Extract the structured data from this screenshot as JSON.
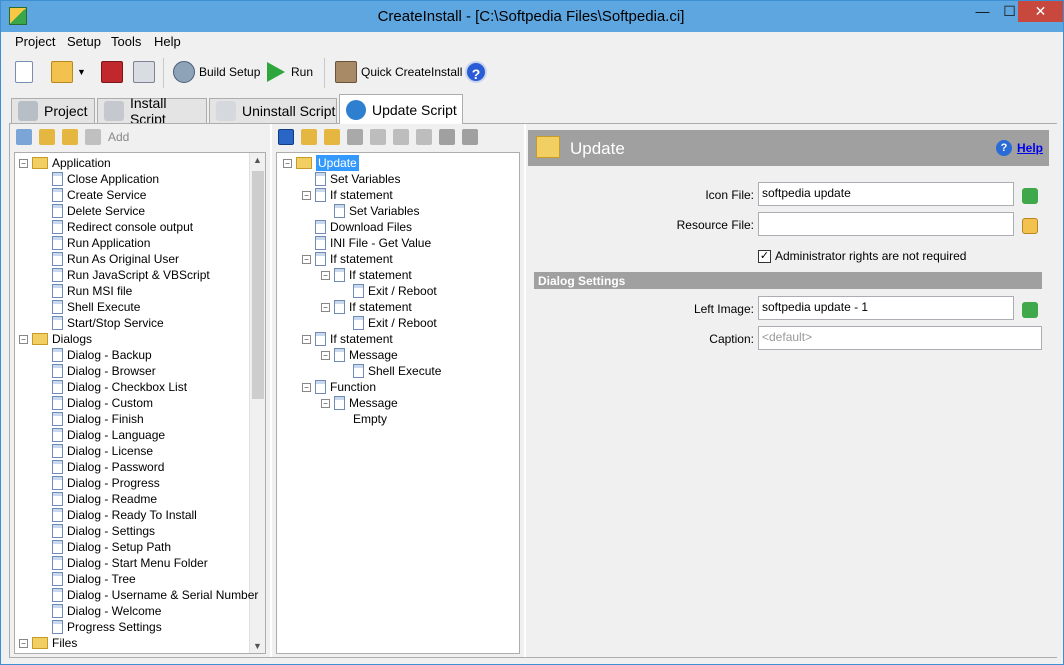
{
  "window": {
    "title": "CreateInstall - [C:\\Softpedia Files\\Softpedia.ci]",
    "min": "—",
    "max": "☐",
    "close": "✕"
  },
  "menu": [
    "Project",
    "Setup",
    "Tools",
    "Help"
  ],
  "toolbar": {
    "build": "Build Setup",
    "run": "Run",
    "quick": "Quick CreateInstall",
    "help": "?"
  },
  "tabs": [
    "Project",
    "Install Script",
    "Uninstall Script",
    "Update Script"
  ],
  "left": {
    "add": "Add",
    "items": [
      {
        "t": "Application",
        "f": 1,
        "l": 0
      },
      {
        "t": "Close Application",
        "l": 1
      },
      {
        "t": "Create Service",
        "l": 1
      },
      {
        "t": "Delete Service",
        "l": 1
      },
      {
        "t": "Redirect console output",
        "l": 1
      },
      {
        "t": "Run Application",
        "l": 1
      },
      {
        "t": "Run As Original User",
        "l": 1
      },
      {
        "t": "Run JavaScript & VBScript",
        "l": 1
      },
      {
        "t": "Run MSI file",
        "l": 1
      },
      {
        "t": "Shell Execute",
        "l": 1
      },
      {
        "t": "Start/Stop Service",
        "l": 1
      },
      {
        "t": "Dialogs",
        "f": 1,
        "l": 0
      },
      {
        "t": "Dialog - Backup",
        "l": 1
      },
      {
        "t": "Dialog - Browser",
        "l": 1
      },
      {
        "t": "Dialog - Checkbox List",
        "l": 1
      },
      {
        "t": "Dialog - Custom",
        "l": 1
      },
      {
        "t": "Dialog - Finish",
        "l": 1
      },
      {
        "t": "Dialog - Language",
        "l": 1
      },
      {
        "t": "Dialog - License",
        "l": 1
      },
      {
        "t": "Dialog - Password",
        "l": 1
      },
      {
        "t": "Dialog - Progress",
        "l": 1
      },
      {
        "t": "Dialog - Readme",
        "l": 1
      },
      {
        "t": "Dialog - Ready To Install",
        "l": 1
      },
      {
        "t": "Dialog - Settings",
        "l": 1
      },
      {
        "t": "Dialog - Setup Path",
        "l": 1
      },
      {
        "t": "Dialog - Start Menu Folder",
        "l": 1
      },
      {
        "t": "Dialog - Tree",
        "l": 1
      },
      {
        "t": "Dialog - Username & Serial Number",
        "l": 1
      },
      {
        "t": "Dialog - Welcome",
        "l": 1
      },
      {
        "t": "Progress Settings",
        "l": 1
      },
      {
        "t": "Files",
        "f": 1,
        "l": 0
      }
    ]
  },
  "middle": {
    "items": [
      {
        "t": "Update",
        "f": 1,
        "l": 0,
        "sel": 1
      },
      {
        "t": "Set Variables",
        "l": 1
      },
      {
        "t": "If statement",
        "l": 1,
        "e": 1
      },
      {
        "t": "Set Variables",
        "l": 2
      },
      {
        "t": "Download Files",
        "l": 1
      },
      {
        "t": "INI File - Get Value",
        "l": 1
      },
      {
        "t": "If statement",
        "l": 1,
        "e": 1
      },
      {
        "t": "If statement",
        "l": 2,
        "e": 1
      },
      {
        "t": "Exit / Reboot",
        "l": 3
      },
      {
        "t": "If statement",
        "l": 2,
        "e": 1
      },
      {
        "t": "Exit / Reboot",
        "l": 3
      },
      {
        "t": "If statement",
        "l": 1,
        "e": 1
      },
      {
        "t": "Message",
        "l": 2,
        "e": 1
      },
      {
        "t": "Shell Execute",
        "l": 3
      },
      {
        "t": "Function",
        "l": 1,
        "e": 1
      },
      {
        "t": "Message",
        "l": 2,
        "e": 1
      },
      {
        "t": "Empty",
        "l": 3,
        "n": 1
      }
    ]
  },
  "right": {
    "title": "Update",
    "help": "Help",
    "icon_file_label": "Icon File:",
    "icon_file_value": "softpedia update",
    "resource_file_label": "Resource File:",
    "resource_file_value": "",
    "admin_checkbox": "Administrator rights are not required",
    "admin_checked": true,
    "section": "Dialog Settings",
    "left_image_label": "Left Image:",
    "left_image_value": "softpedia update - 1",
    "caption_label": "Caption:",
    "caption_placeholder": "<default>"
  }
}
